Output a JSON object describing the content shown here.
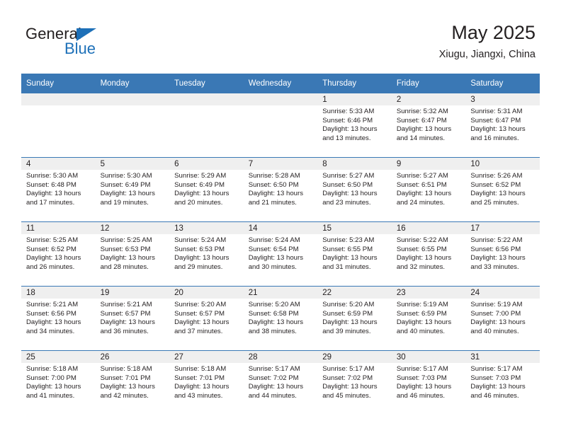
{
  "logo": {
    "line1": "General",
    "line2": "Blue",
    "triangle_icon": "blue-triangle-icon",
    "blue": "#1d70b8",
    "dark": "#231f20"
  },
  "header": {
    "title": "May 2025",
    "subtitle": "Xiugu, Jiangxi, China"
  },
  "theme": {
    "header_bar": "#3a78b5",
    "daynum_band": "#efefef",
    "text": "#231f20",
    "cell_bg": "#ffffff"
  },
  "weekday_headers": [
    "Sunday",
    "Monday",
    "Tuesday",
    "Wednesday",
    "Thursday",
    "Friday",
    "Saturday"
  ],
  "weeks": [
    [
      {
        "day": "",
        "empty": true
      },
      {
        "day": "",
        "empty": true
      },
      {
        "day": "",
        "empty": true
      },
      {
        "day": "",
        "empty": true
      },
      {
        "day": "1",
        "sunrise": "Sunrise: 5:33 AM",
        "sunset": "Sunset: 6:46 PM",
        "daylight": "Daylight: 13 hours and 13 minutes."
      },
      {
        "day": "2",
        "sunrise": "Sunrise: 5:32 AM",
        "sunset": "Sunset: 6:47 PM",
        "daylight": "Daylight: 13 hours and 14 minutes."
      },
      {
        "day": "3",
        "sunrise": "Sunrise: 5:31 AM",
        "sunset": "Sunset: 6:47 PM",
        "daylight": "Daylight: 13 hours and 16 minutes."
      }
    ],
    [
      {
        "day": "4",
        "sunrise": "Sunrise: 5:30 AM",
        "sunset": "Sunset: 6:48 PM",
        "daylight": "Daylight: 13 hours and 17 minutes."
      },
      {
        "day": "5",
        "sunrise": "Sunrise: 5:30 AM",
        "sunset": "Sunset: 6:49 PM",
        "daylight": "Daylight: 13 hours and 19 minutes."
      },
      {
        "day": "6",
        "sunrise": "Sunrise: 5:29 AM",
        "sunset": "Sunset: 6:49 PM",
        "daylight": "Daylight: 13 hours and 20 minutes."
      },
      {
        "day": "7",
        "sunrise": "Sunrise: 5:28 AM",
        "sunset": "Sunset: 6:50 PM",
        "daylight": "Daylight: 13 hours and 21 minutes."
      },
      {
        "day": "8",
        "sunrise": "Sunrise: 5:27 AM",
        "sunset": "Sunset: 6:50 PM",
        "daylight": "Daylight: 13 hours and 23 minutes."
      },
      {
        "day": "9",
        "sunrise": "Sunrise: 5:27 AM",
        "sunset": "Sunset: 6:51 PM",
        "daylight": "Daylight: 13 hours and 24 minutes."
      },
      {
        "day": "10",
        "sunrise": "Sunrise: 5:26 AM",
        "sunset": "Sunset: 6:52 PM",
        "daylight": "Daylight: 13 hours and 25 minutes."
      }
    ],
    [
      {
        "day": "11",
        "sunrise": "Sunrise: 5:25 AM",
        "sunset": "Sunset: 6:52 PM",
        "daylight": "Daylight: 13 hours and 26 minutes."
      },
      {
        "day": "12",
        "sunrise": "Sunrise: 5:25 AM",
        "sunset": "Sunset: 6:53 PM",
        "daylight": "Daylight: 13 hours and 28 minutes."
      },
      {
        "day": "13",
        "sunrise": "Sunrise: 5:24 AM",
        "sunset": "Sunset: 6:53 PM",
        "daylight": "Daylight: 13 hours and 29 minutes."
      },
      {
        "day": "14",
        "sunrise": "Sunrise: 5:24 AM",
        "sunset": "Sunset: 6:54 PM",
        "daylight": "Daylight: 13 hours and 30 minutes."
      },
      {
        "day": "15",
        "sunrise": "Sunrise: 5:23 AM",
        "sunset": "Sunset: 6:55 PM",
        "daylight": "Daylight: 13 hours and 31 minutes."
      },
      {
        "day": "16",
        "sunrise": "Sunrise: 5:22 AM",
        "sunset": "Sunset: 6:55 PM",
        "daylight": "Daylight: 13 hours and 32 minutes."
      },
      {
        "day": "17",
        "sunrise": "Sunrise: 5:22 AM",
        "sunset": "Sunset: 6:56 PM",
        "daylight": "Daylight: 13 hours and 33 minutes."
      }
    ],
    [
      {
        "day": "18",
        "sunrise": "Sunrise: 5:21 AM",
        "sunset": "Sunset: 6:56 PM",
        "daylight": "Daylight: 13 hours and 34 minutes."
      },
      {
        "day": "19",
        "sunrise": "Sunrise: 5:21 AM",
        "sunset": "Sunset: 6:57 PM",
        "daylight": "Daylight: 13 hours and 36 minutes."
      },
      {
        "day": "20",
        "sunrise": "Sunrise: 5:20 AM",
        "sunset": "Sunset: 6:57 PM",
        "daylight": "Daylight: 13 hours and 37 minutes."
      },
      {
        "day": "21",
        "sunrise": "Sunrise: 5:20 AM",
        "sunset": "Sunset: 6:58 PM",
        "daylight": "Daylight: 13 hours and 38 minutes."
      },
      {
        "day": "22",
        "sunrise": "Sunrise: 5:20 AM",
        "sunset": "Sunset: 6:59 PM",
        "daylight": "Daylight: 13 hours and 39 minutes."
      },
      {
        "day": "23",
        "sunrise": "Sunrise: 5:19 AM",
        "sunset": "Sunset: 6:59 PM",
        "daylight": "Daylight: 13 hours and 40 minutes."
      },
      {
        "day": "24",
        "sunrise": "Sunrise: 5:19 AM",
        "sunset": "Sunset: 7:00 PM",
        "daylight": "Daylight: 13 hours and 40 minutes."
      }
    ],
    [
      {
        "day": "25",
        "sunrise": "Sunrise: 5:18 AM",
        "sunset": "Sunset: 7:00 PM",
        "daylight": "Daylight: 13 hours and 41 minutes."
      },
      {
        "day": "26",
        "sunrise": "Sunrise: 5:18 AM",
        "sunset": "Sunset: 7:01 PM",
        "daylight": "Daylight: 13 hours and 42 minutes."
      },
      {
        "day": "27",
        "sunrise": "Sunrise: 5:18 AM",
        "sunset": "Sunset: 7:01 PM",
        "daylight": "Daylight: 13 hours and 43 minutes."
      },
      {
        "day": "28",
        "sunrise": "Sunrise: 5:17 AM",
        "sunset": "Sunset: 7:02 PM",
        "daylight": "Daylight: 13 hours and 44 minutes."
      },
      {
        "day": "29",
        "sunrise": "Sunrise: 5:17 AM",
        "sunset": "Sunset: 7:02 PM",
        "daylight": "Daylight: 13 hours and 45 minutes."
      },
      {
        "day": "30",
        "sunrise": "Sunrise: 5:17 AM",
        "sunset": "Sunset: 7:03 PM",
        "daylight": "Daylight: 13 hours and 46 minutes."
      },
      {
        "day": "31",
        "sunrise": "Sunrise: 5:17 AM",
        "sunset": "Sunset: 7:03 PM",
        "daylight": "Daylight: 13 hours and 46 minutes."
      }
    ]
  ]
}
